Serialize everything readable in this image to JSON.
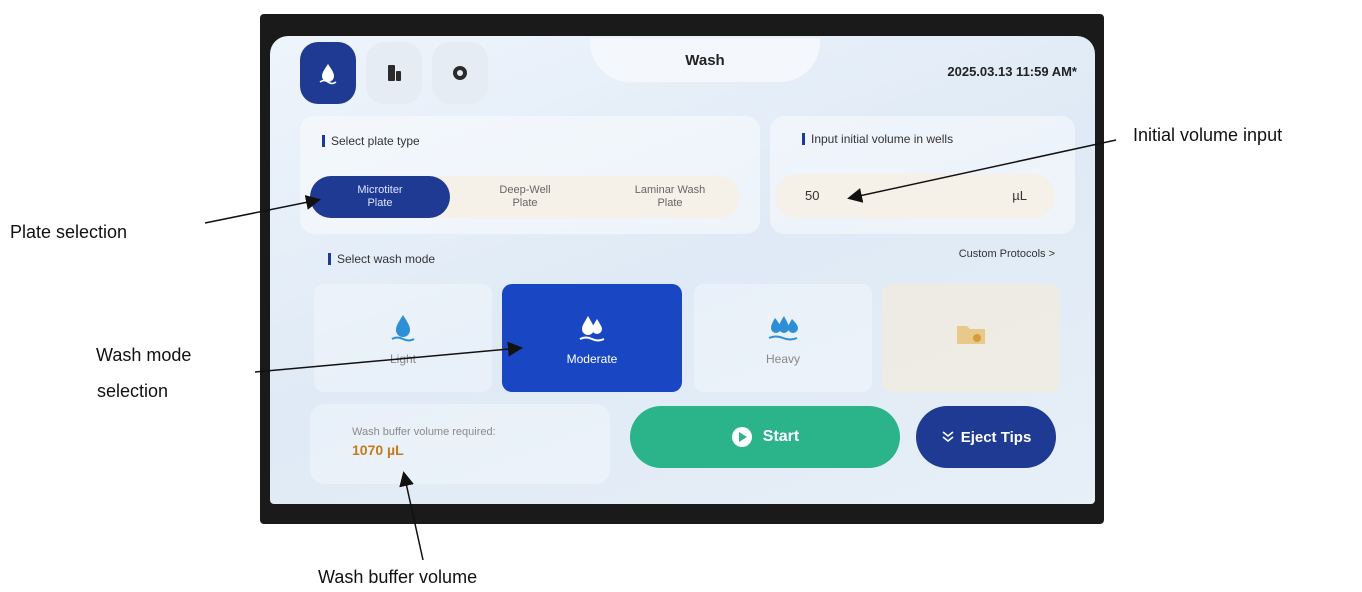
{
  "header": {
    "title": "Wash",
    "datetime": "2025.03.13   11:59 AM*"
  },
  "plate": {
    "section_label": "Select plate type",
    "options": [
      {
        "line1": "Microtiter",
        "line2": "Plate",
        "selected": true
      },
      {
        "line1": "Deep-Well",
        "line2": "Plate",
        "selected": false
      },
      {
        "line1": "Laminar Wash",
        "line2": "Plate",
        "selected": false
      }
    ]
  },
  "volume": {
    "section_label": "Input initial volume in wells",
    "value": "50",
    "unit": "µL"
  },
  "wash_mode": {
    "section_label": "Select wash mode",
    "custom_link": "Custom Protocols >",
    "modes": [
      {
        "label": "Light",
        "selected": false
      },
      {
        "label": "Moderate",
        "selected": true
      },
      {
        "label": "Heavy",
        "selected": false
      },
      {
        "label": "",
        "selected": false
      }
    ]
  },
  "buffer": {
    "label": "Wash buffer volume required:",
    "value": "1070 µL"
  },
  "actions": {
    "start_label": "Start",
    "eject_label": "Eject Tips"
  },
  "annotations": {
    "initial_volume": "Initial  volume input",
    "plate_selection": "Plate selection",
    "wash_mode_line1": "Wash mode",
    "wash_mode_line2": "selection",
    "wash_buffer": "Wash buffer volume"
  },
  "colors": {
    "primary": "#1f3a93",
    "selected_mode": "#1947c4",
    "start": "#2bb38a",
    "buffer_value": "#c47a1e"
  }
}
